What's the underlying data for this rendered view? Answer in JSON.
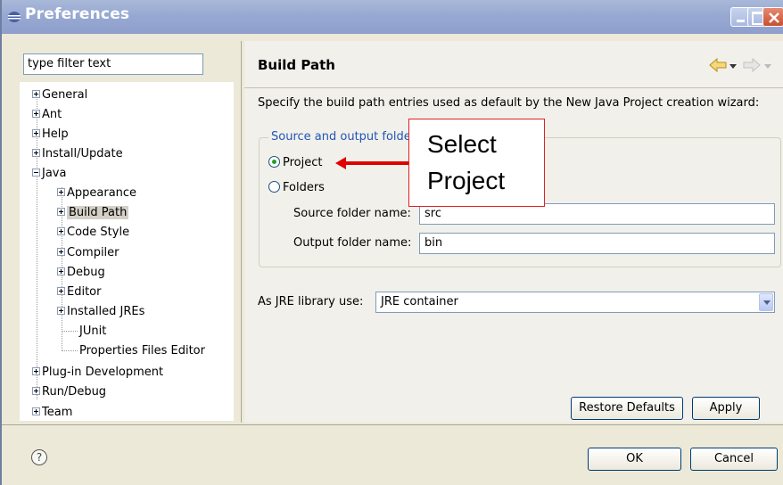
{
  "window": {
    "title": "Preferences"
  },
  "filter": {
    "value": "type filter text"
  },
  "tree": {
    "items": [
      {
        "label": "General",
        "expanded": false
      },
      {
        "label": "Ant",
        "expanded": false
      },
      {
        "label": "Help",
        "expanded": false
      },
      {
        "label": "Install/Update",
        "expanded": false
      },
      {
        "label": "Java",
        "expanded": true
      },
      {
        "label": "Appearance",
        "expanded": false
      },
      {
        "label": "Build Path",
        "expanded": false,
        "selected": true
      },
      {
        "label": "Code Style",
        "expanded": false
      },
      {
        "label": "Compiler",
        "expanded": false
      },
      {
        "label": "Debug",
        "expanded": false
      },
      {
        "label": "Editor",
        "expanded": false
      },
      {
        "label": "Installed JREs",
        "expanded": false
      },
      {
        "label": "JUnit"
      },
      {
        "label": "Properties Files Editor"
      },
      {
        "label": "Plug-in Development",
        "expanded": false
      },
      {
        "label": "Run/Debug",
        "expanded": false
      },
      {
        "label": "Team",
        "expanded": false
      }
    ]
  },
  "page": {
    "title": "Build Path",
    "description": "Specify the build path entries used as default by the New Java Project creation wizard:",
    "group_label": "Source and output folde",
    "radio_project": "Project",
    "radio_folders": "Folders",
    "selected_radio": "Project",
    "source_label": "Source folder name:",
    "source_value": "src",
    "output_label": "Output folder name:",
    "output_value": "bin",
    "jre_label": "As JRE library use:",
    "jre_value": "JRE container",
    "restore_defaults": "Restore Defaults",
    "apply": "Apply"
  },
  "dialog_buttons": {
    "ok": "OK",
    "cancel": "Cancel"
  },
  "callout": {
    "line1": "Select",
    "line2": "Project"
  },
  "colors": {
    "titlebar": "#97a9d3",
    "group_label": "#2255b8",
    "callout_border": "#e02020",
    "arrow": "#e00000"
  }
}
